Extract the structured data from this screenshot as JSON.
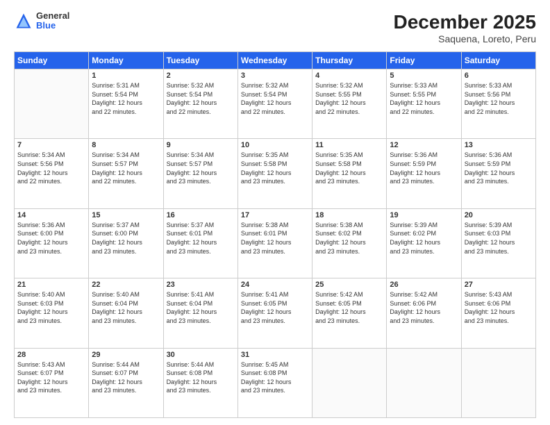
{
  "header": {
    "logo_general": "General",
    "logo_blue": "Blue",
    "month_year": "December 2025",
    "location": "Saquena, Loreto, Peru"
  },
  "days_of_week": [
    "Sunday",
    "Monday",
    "Tuesday",
    "Wednesday",
    "Thursday",
    "Friday",
    "Saturday"
  ],
  "weeks": [
    [
      {
        "day": "",
        "lines": []
      },
      {
        "day": "1",
        "lines": [
          "Sunrise: 5:31 AM",
          "Sunset: 5:54 PM",
          "Daylight: 12 hours",
          "and 22 minutes."
        ]
      },
      {
        "day": "2",
        "lines": [
          "Sunrise: 5:32 AM",
          "Sunset: 5:54 PM",
          "Daylight: 12 hours",
          "and 22 minutes."
        ]
      },
      {
        "day": "3",
        "lines": [
          "Sunrise: 5:32 AM",
          "Sunset: 5:54 PM",
          "Daylight: 12 hours",
          "and 22 minutes."
        ]
      },
      {
        "day": "4",
        "lines": [
          "Sunrise: 5:32 AM",
          "Sunset: 5:55 PM",
          "Daylight: 12 hours",
          "and 22 minutes."
        ]
      },
      {
        "day": "5",
        "lines": [
          "Sunrise: 5:33 AM",
          "Sunset: 5:55 PM",
          "Daylight: 12 hours",
          "and 22 minutes."
        ]
      },
      {
        "day": "6",
        "lines": [
          "Sunrise: 5:33 AM",
          "Sunset: 5:56 PM",
          "Daylight: 12 hours",
          "and 22 minutes."
        ]
      }
    ],
    [
      {
        "day": "7",
        "lines": [
          "Sunrise: 5:34 AM",
          "Sunset: 5:56 PM",
          "Daylight: 12 hours",
          "and 22 minutes."
        ]
      },
      {
        "day": "8",
        "lines": [
          "Sunrise: 5:34 AM",
          "Sunset: 5:57 PM",
          "Daylight: 12 hours",
          "and 22 minutes."
        ]
      },
      {
        "day": "9",
        "lines": [
          "Sunrise: 5:34 AM",
          "Sunset: 5:57 PM",
          "Daylight: 12 hours",
          "and 23 minutes."
        ]
      },
      {
        "day": "10",
        "lines": [
          "Sunrise: 5:35 AM",
          "Sunset: 5:58 PM",
          "Daylight: 12 hours",
          "and 23 minutes."
        ]
      },
      {
        "day": "11",
        "lines": [
          "Sunrise: 5:35 AM",
          "Sunset: 5:58 PM",
          "Daylight: 12 hours",
          "and 23 minutes."
        ]
      },
      {
        "day": "12",
        "lines": [
          "Sunrise: 5:36 AM",
          "Sunset: 5:59 PM",
          "Daylight: 12 hours",
          "and 23 minutes."
        ]
      },
      {
        "day": "13",
        "lines": [
          "Sunrise: 5:36 AM",
          "Sunset: 5:59 PM",
          "Daylight: 12 hours",
          "and 23 minutes."
        ]
      }
    ],
    [
      {
        "day": "14",
        "lines": [
          "Sunrise: 5:36 AM",
          "Sunset: 6:00 PM",
          "Daylight: 12 hours",
          "and 23 minutes."
        ]
      },
      {
        "day": "15",
        "lines": [
          "Sunrise: 5:37 AM",
          "Sunset: 6:00 PM",
          "Daylight: 12 hours",
          "and 23 minutes."
        ]
      },
      {
        "day": "16",
        "lines": [
          "Sunrise: 5:37 AM",
          "Sunset: 6:01 PM",
          "Daylight: 12 hours",
          "and 23 minutes."
        ]
      },
      {
        "day": "17",
        "lines": [
          "Sunrise: 5:38 AM",
          "Sunset: 6:01 PM",
          "Daylight: 12 hours",
          "and 23 minutes."
        ]
      },
      {
        "day": "18",
        "lines": [
          "Sunrise: 5:38 AM",
          "Sunset: 6:02 PM",
          "Daylight: 12 hours",
          "and 23 minutes."
        ]
      },
      {
        "day": "19",
        "lines": [
          "Sunrise: 5:39 AM",
          "Sunset: 6:02 PM",
          "Daylight: 12 hours",
          "and 23 minutes."
        ]
      },
      {
        "day": "20",
        "lines": [
          "Sunrise: 5:39 AM",
          "Sunset: 6:03 PM",
          "Daylight: 12 hours",
          "and 23 minutes."
        ]
      }
    ],
    [
      {
        "day": "21",
        "lines": [
          "Sunrise: 5:40 AM",
          "Sunset: 6:03 PM",
          "Daylight: 12 hours",
          "and 23 minutes."
        ]
      },
      {
        "day": "22",
        "lines": [
          "Sunrise: 5:40 AM",
          "Sunset: 6:04 PM",
          "Daylight: 12 hours",
          "and 23 minutes."
        ]
      },
      {
        "day": "23",
        "lines": [
          "Sunrise: 5:41 AM",
          "Sunset: 6:04 PM",
          "Daylight: 12 hours",
          "and 23 minutes."
        ]
      },
      {
        "day": "24",
        "lines": [
          "Sunrise: 5:41 AM",
          "Sunset: 6:05 PM",
          "Daylight: 12 hours",
          "and 23 minutes."
        ]
      },
      {
        "day": "25",
        "lines": [
          "Sunrise: 5:42 AM",
          "Sunset: 6:05 PM",
          "Daylight: 12 hours",
          "and 23 minutes."
        ]
      },
      {
        "day": "26",
        "lines": [
          "Sunrise: 5:42 AM",
          "Sunset: 6:06 PM",
          "Daylight: 12 hours",
          "and 23 minutes."
        ]
      },
      {
        "day": "27",
        "lines": [
          "Sunrise: 5:43 AM",
          "Sunset: 6:06 PM",
          "Daylight: 12 hours",
          "and 23 minutes."
        ]
      }
    ],
    [
      {
        "day": "28",
        "lines": [
          "Sunrise: 5:43 AM",
          "Sunset: 6:07 PM",
          "Daylight: 12 hours",
          "and 23 minutes."
        ]
      },
      {
        "day": "29",
        "lines": [
          "Sunrise: 5:44 AM",
          "Sunset: 6:07 PM",
          "Daylight: 12 hours",
          "and 23 minutes."
        ]
      },
      {
        "day": "30",
        "lines": [
          "Sunrise: 5:44 AM",
          "Sunset: 6:08 PM",
          "Daylight: 12 hours",
          "and 23 minutes."
        ]
      },
      {
        "day": "31",
        "lines": [
          "Sunrise: 5:45 AM",
          "Sunset: 6:08 PM",
          "Daylight: 12 hours",
          "and 23 minutes."
        ]
      },
      {
        "day": "",
        "lines": []
      },
      {
        "day": "",
        "lines": []
      },
      {
        "day": "",
        "lines": []
      }
    ]
  ]
}
